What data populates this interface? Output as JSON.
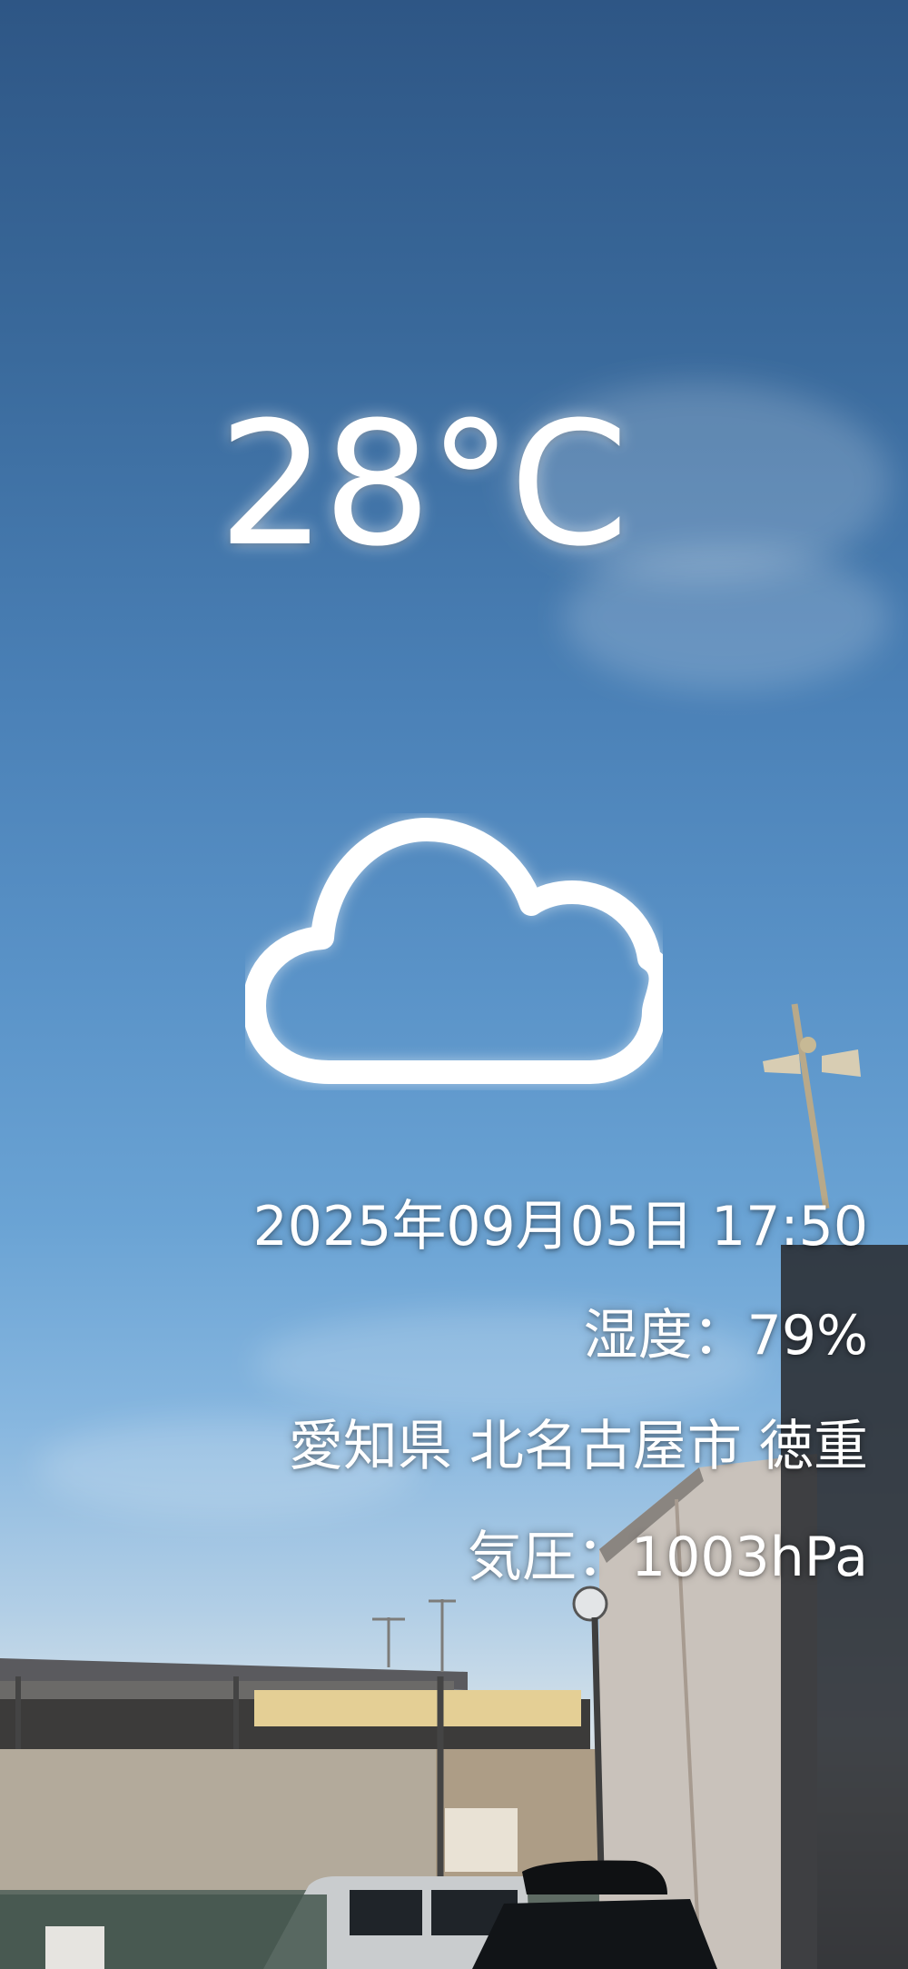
{
  "weather": {
    "temperature": "28°C",
    "condition_icon": "cloud-icon"
  },
  "details": {
    "datetime": "2025年09月05日  17:50",
    "humidity": "湿度：79%",
    "location": "愛知県  北名古屋市  徳重",
    "pressure": "気圧：1003hPa"
  },
  "colors": {
    "sky_top": "#2e5685",
    "sky_mid": "#5a93c8",
    "horizon": "#d6e2ea",
    "text": "#ffffff"
  }
}
